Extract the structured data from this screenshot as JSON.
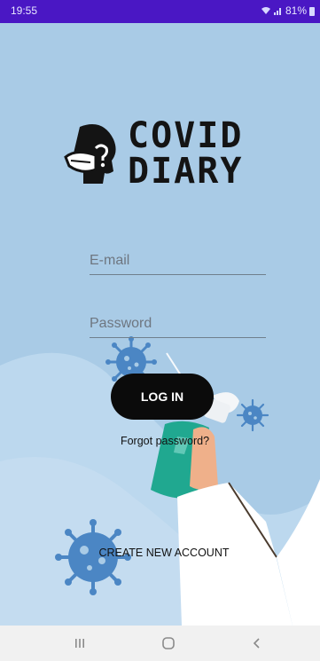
{
  "status_bar": {
    "time": "19:55",
    "battery": "81%",
    "icons": [
      "wifi-icon",
      "signal-icon",
      "battery-icon"
    ]
  },
  "logo": {
    "line1": "COVID",
    "line2": "DIARY"
  },
  "login_form": {
    "email_placeholder": "E-mail",
    "password_placeholder": "Password",
    "login_label": "LOG IN",
    "forgot_label": "Forgot password?",
    "create_account_label": "CREATE NEW ACCOUNT"
  },
  "nav_bar": {
    "icons": [
      "recent-apps-icon",
      "home-icon",
      "back-icon"
    ]
  },
  "colors": {
    "status_bar": "#4a17c4",
    "background": "#a9cbe6",
    "virus": "#4b86c4",
    "button": "#0b0b0b",
    "bottle": "#20a890"
  }
}
